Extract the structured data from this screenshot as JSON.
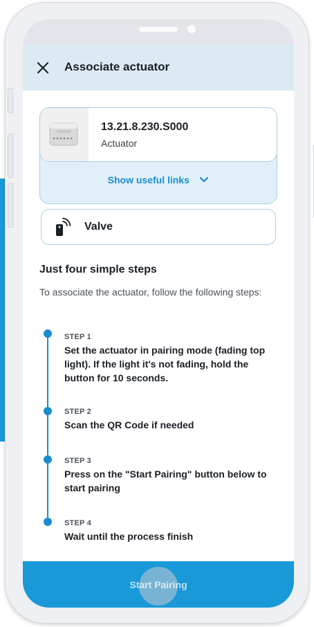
{
  "header": {
    "title": "Associate actuator"
  },
  "device": {
    "model": "13.21.8.230.S000",
    "type": "Actuator",
    "links_label": "Show useful links"
  },
  "valve": {
    "label": "Valve"
  },
  "steps_section": {
    "title": "Just four simple steps",
    "subtitle": "To associate the actuator, follow the following steps:"
  },
  "steps": [
    {
      "label": "STEP 1",
      "text": "Set the actuator in pairing mode (fading top light). If the light it's not fading, hold the button for 10 seconds."
    },
    {
      "label": "STEP 2",
      "text": "Scan the QR Code if needed"
    },
    {
      "label": "STEP 3",
      "text": "Press on the \"Start Pairing\" button below to start pairing"
    },
    {
      "label": "STEP 4",
      "text": "Wait until the process finish"
    }
  ],
  "footer": {
    "button_label": "Start Pairing"
  },
  "colors": {
    "accent": "#1a99d9",
    "header_bg": "#dcebf3",
    "link": "#1a8dcc"
  },
  "icons": {
    "close": "close-icon",
    "chevron": "chevron-down-icon",
    "valve": "remote-signal-icon"
  }
}
